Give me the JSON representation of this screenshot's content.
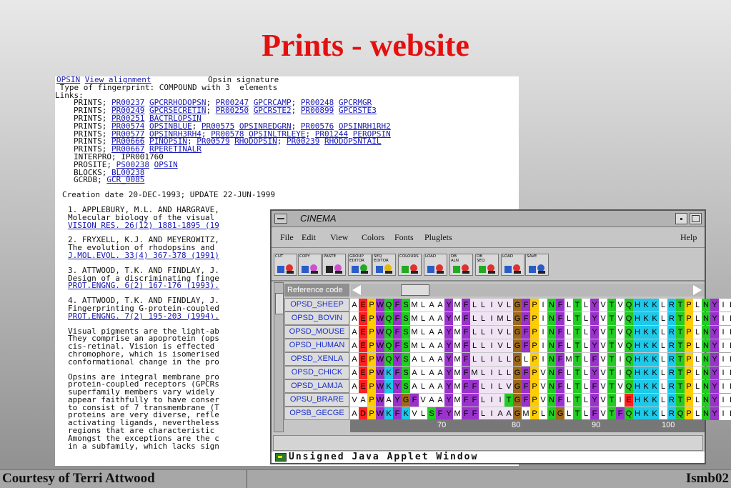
{
  "slide": {
    "title": "Prints - website",
    "footer_left": "Courtesy of Terri Attwood",
    "footer_right": "Ismb02"
  },
  "webpage": {
    "header_link1": "OPSIN",
    "header_link2": "View alignment",
    "header_title": "Opsin signature",
    "fingerprint_type": " Type of fingerprint: COMPOUND with 3  elements",
    "links_label": "Links:",
    "prints_rows": [
      [
        [
          "PR00237",
          "GPCRRHODOPSN"
        ],
        [
          "PR00247",
          "GPCRCAMP"
        ],
        [
          "PR00248",
          "GPCRMGR"
        ]
      ],
      [
        [
          "PR00249",
          "GPCRSECRETIN"
        ],
        [
          "PR00250",
          "GPCRSTE2"
        ],
        [
          "PR00899",
          "GPCRSTE3"
        ]
      ],
      [
        [
          "PR00251",
          "BACTRLOPSIN"
        ]
      ],
      [
        [
          "PR00574",
          "OPSINBLUE"
        ],
        [
          "PR00575",
          "OPSINREDGRN"
        ],
        [
          "PR00576",
          "OPSINRH1RH2"
        ]
      ],
      [
        [
          "PR00577",
          "OPSINRH3RH4"
        ],
        [
          "PR00578",
          "OPSINLTRLEYE"
        ],
        [
          "PR01244",
          "PEROPSIN"
        ]
      ],
      [
        [
          "PR00666",
          "PINOPSIN"
        ],
        [
          "PR00579",
          "RHODOPSIN"
        ],
        [
          "PR00239",
          "RHODOPSNTAIL"
        ]
      ],
      [
        [
          "PR00667",
          "RPERETINALR"
        ]
      ]
    ],
    "interpro": "INTERPRO; IPR001760",
    "prosite": [
      [
        "PS00238",
        "OPSIN"
      ]
    ],
    "blocks": [
      [
        "BL00238"
      ]
    ],
    "gcrdb": [
      [
        "GCR_0085"
      ]
    ],
    "creation": "Creation date 20-DEC-1993; UPDATE 22-JUN-1999",
    "refs": [
      {
        "l1": "1. APPLEBURY, M.L. AND HARGRAVE,",
        "l2": "Molecular biology of the visual",
        "link": "VISION RES. 26(12) 1881-1895 (19"
      },
      {
        "l1": "2. FRYXELL, K.J. AND MEYEROWITZ,",
        "l2": "The evolution of rhodopsins and",
        "link": "J.MOL.EVOL. 33(4) 367-378 (1991)"
      },
      {
        "l1": "3. ATTWOOD, T.K. AND FINDLAY, J.",
        "l2": "Design of a discriminating finge",
        "link": "PROT.ENGNG. 6(2) 167-176 (1993)."
      },
      {
        "l1": "4. ATTWOOD, T.K. AND FINDLAY, J.",
        "l2": "Fingerprinting G-protein-coupled",
        "link": "PROT.ENGNG. 7(2) 195-203 (1994)."
      }
    ],
    "para1": [
      "Visual pigments are the light-ab",
      "They comprise an apoprotein (ops",
      "cis-retinal. Vision is effected",
      "chromophore, which is isomerised",
      "conformational change in the pro"
    ],
    "para2": [
      "Opsins are integral membrane pro",
      "protein-coupled receptors (GPCRs",
      "superfamily members vary widely",
      "appear faithfully to have conser",
      "to consist of 7 transmembrane (T",
      "proteins are very diverse, refle",
      "activating ligands, nevertheless",
      "regions that are characteristic",
      "Amongst the exceptions are the c",
      "in a subfamily, which lacks sign"
    ]
  },
  "cinema": {
    "title": "CINEMA",
    "menus": [
      "File",
      "Edit",
      "View",
      "Colors",
      "Fonts",
      "Pluglets"
    ],
    "help": "Help",
    "tools": [
      {
        "label": "CUT",
        "icon": "cut-icon"
      },
      {
        "label": "COPY",
        "icon": "copy-icon"
      },
      {
        "label": "PASTE",
        "icon": "paste-icon"
      },
      {
        "label": "GROUP\nEDITOR",
        "icon": "group-editor-icon"
      },
      {
        "label": "SEQ\nEDITOR",
        "icon": "seq-editor-icon"
      },
      {
        "label": "COLOURS",
        "icon": "colours-icon"
      },
      {
        "label": "LOAD",
        "icon": "load-icon"
      },
      {
        "label": "DB\nALN",
        "icon": "db-aln-icon"
      },
      {
        "label": "DB\nSEQ",
        "icon": "db-seq-icon"
      },
      {
        "label": "LOAD",
        "icon": "load-icon"
      },
      {
        "label": "SAVE",
        "icon": "save-icon"
      }
    ],
    "reference_code_label": "Reference code",
    "sequences": [
      {
        "name": "OPSD_SHEEP",
        "seq": "AEPWQFSMLAAYMFLLIVLGFPINFLTLYVTVQHKKLRTPLNYILLN"
      },
      {
        "name": "OPSD_BOVIN",
        "seq": "AEPWQFSMLAAYMFLLIMLGFPINFLTLYVTVQHKKLRTPLNYILLN"
      },
      {
        "name": "OPSD_MOUSE",
        "seq": "AEPWQFSMLAAYMFLLIVLGFPINFLTLYVTVQHKKLRTPLNYILLN"
      },
      {
        "name": "OPSD_HUMAN",
        "seq": "AEPWQFSMLAAYMFLLIVLGFPINFLTLYVTVQHKKLRTPLNYILLN"
      },
      {
        "name": "OPSD_XENLA",
        "seq": "AEPWQYSALAAYMFLLILLGLPINFMTLFVTIQHKKLRTPLNYILLN"
      },
      {
        "name": "OPSD_CHICK",
        "seq": "AEPWKFSALAAYMFMLILLGFPVNFLTLYVTIQHKKLRTPLNYILLN"
      },
      {
        "name": "OPSD_LAMJA",
        "seq": "AEPWKYSALAAYMFFLILVGFPVNFLTLFVTVQHKKLRTPLNYILLN"
      },
      {
        "name": "OPSU_BRARE",
        "seq": "VAPWAYGFVAAYMFFLIITGFPVNFLTLYVTIEHKKLRTPLNYILLN"
      },
      {
        "name": "OPSB_GECGE",
        "seq": "ADPWKFKVLSFYMFFLIAAGMPLNGLTLFVTFQHKKLRQPLNYILVN"
      }
    ],
    "ruler_labels": [
      "70",
      "80",
      "90",
      "100"
    ],
    "applet_status": "Unsigned Java Applet Window",
    "residue_colors": {
      "A": "#ffffff",
      "V": "#ffffff",
      "L": "#ffffff",
      "I": "#ffffff",
      "M": "#ffffff",
      "E": "#ff2020",
      "D": "#ff2020",
      "P": "#ffcc00",
      "W": "#9a33cc",
      "F": "#9a33cc",
      "Y": "#9a33cc",
      "Q": "#22cc22",
      "N": "#22cc22",
      "S": "#22cc22",
      "T": "#22cc22",
      "G": "#9c6a1a",
      "K": "#1ec8e8",
      "R": "#1ec8e8",
      "H": "#1ec8e8",
      "C": "#ffff66"
    },
    "residue_tint_columns": "#f0e4f4"
  }
}
